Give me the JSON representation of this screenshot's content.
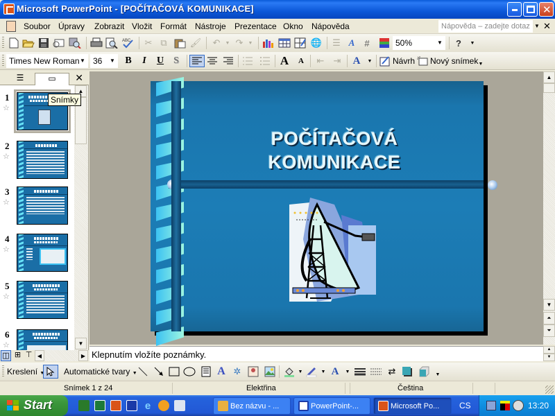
{
  "window": {
    "title": "Microsoft PowerPoint - [POČÍTAČOVÁ KOMUNIKACE]",
    "minimize_glyph": "_",
    "maximize_glyph": "□",
    "close_glyph": "✕"
  },
  "menu": {
    "items": [
      {
        "label": "Soubor"
      },
      {
        "label": "Úpravy"
      },
      {
        "label": "Zobrazit"
      },
      {
        "label": "Vložit"
      },
      {
        "label": "Formát"
      },
      {
        "label": "Nástroje"
      },
      {
        "label": "Prezentace"
      },
      {
        "label": "Okno"
      },
      {
        "label": "Nápověda"
      }
    ],
    "help_placeholder": "Nápověda – zadejte dotaz",
    "close_glyph": "✕"
  },
  "standard_toolbar": {
    "zoom_value": "50%",
    "icons": [
      "new-icon",
      "open-icon",
      "save-icon",
      "email-icon",
      "search-icon",
      "print-icon",
      "print-preview-icon",
      "spelling-icon",
      "cut-icon",
      "copy-icon",
      "paste-icon",
      "format-painter-icon",
      "undo-icon",
      "redo-icon",
      "insert-chart-icon",
      "insert-table-icon",
      "tables-borders-icon",
      "insert-hyperlink-icon",
      "expand-all-icon",
      "show-formatting-icon",
      "show-grid-icon",
      "color-grayscale-icon",
      "help-icon"
    ]
  },
  "formatting_toolbar": {
    "font_name": "Times New Roman",
    "font_size": "36",
    "bold": "B",
    "italic": "I",
    "underline": "U",
    "shadow": "S",
    "design_label": "Návrh",
    "new_slide_label": "Nový snímek"
  },
  "left_pane": {
    "tab_outline_icon": "outline-icon",
    "tab_slides_icon": "slides-icon",
    "close_glyph": "✕",
    "tooltip": "Snímky",
    "slides": [
      {
        "number": "1",
        "selected": true
      },
      {
        "number": "2",
        "selected": false
      },
      {
        "number": "3",
        "selected": false
      },
      {
        "number": "4",
        "selected": false
      },
      {
        "number": "5",
        "selected": false
      },
      {
        "number": "6",
        "selected": false
      }
    ]
  },
  "slide": {
    "title_line1": "POČÍTAČOVÁ",
    "title_line2": "KOMUNIKACE",
    "colors": {
      "background": "#1c7db6",
      "spiral_light": "#9ef6e0",
      "spiral_dark": "#3cc2f2"
    }
  },
  "notes": {
    "placeholder": "Klepnutím vložíte poznámky."
  },
  "drawing_toolbar": {
    "draw_label": "Kreslení",
    "autoshapes_label": "Automatické tvary"
  },
  "statusbar": {
    "slide_info": "Snímek 1 z 24",
    "design": "Elektřina",
    "language": "Čeština"
  },
  "taskbar": {
    "start_label": "Start",
    "tasks": [
      {
        "label": "Bez názvu - ...",
        "active": false
      },
      {
        "label": "PowerPoint-...",
        "active": false
      },
      {
        "label": "Microsoft Po...",
        "active": true
      }
    ],
    "language_indicator": "CS",
    "clock": "13:20"
  }
}
